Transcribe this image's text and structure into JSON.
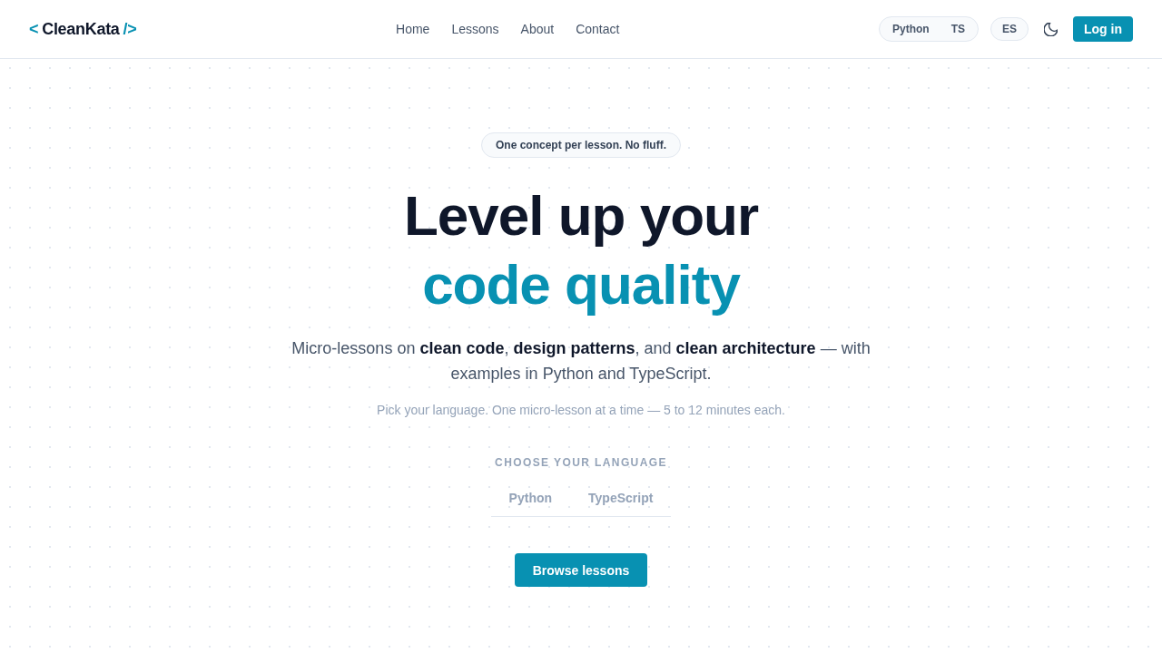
{
  "header": {
    "logo": {
      "open": "<",
      "name": "CleanKata",
      "close": "/>"
    },
    "nav": [
      "Home",
      "Lessons",
      "About",
      "Contact"
    ],
    "code_toggle": [
      {
        "label": "Python",
        "selected": false
      },
      {
        "label": "TS",
        "selected": false
      }
    ],
    "locale_button": "ES",
    "login_button": "Log in"
  },
  "hero": {
    "badge": "One concept per lesson. No fluff.",
    "headline": "Level up your",
    "headline_accent": "code quality",
    "lead": "Micro-lessons on **clean code**, **design patterns**, and **clean architecture** — with examples in Python and TypeScript.",
    "note": "Pick your language. One micro-lesson at a time — 5 to 12 minutes each.",
    "language_label": "CHOOSE YOUR LANGUAGE",
    "language_tabs": [
      {
        "label": "Python",
        "selected": false
      },
      {
        "label": "TypeScript",
        "selected": false
      }
    ],
    "cta": "Browse lessons"
  }
}
